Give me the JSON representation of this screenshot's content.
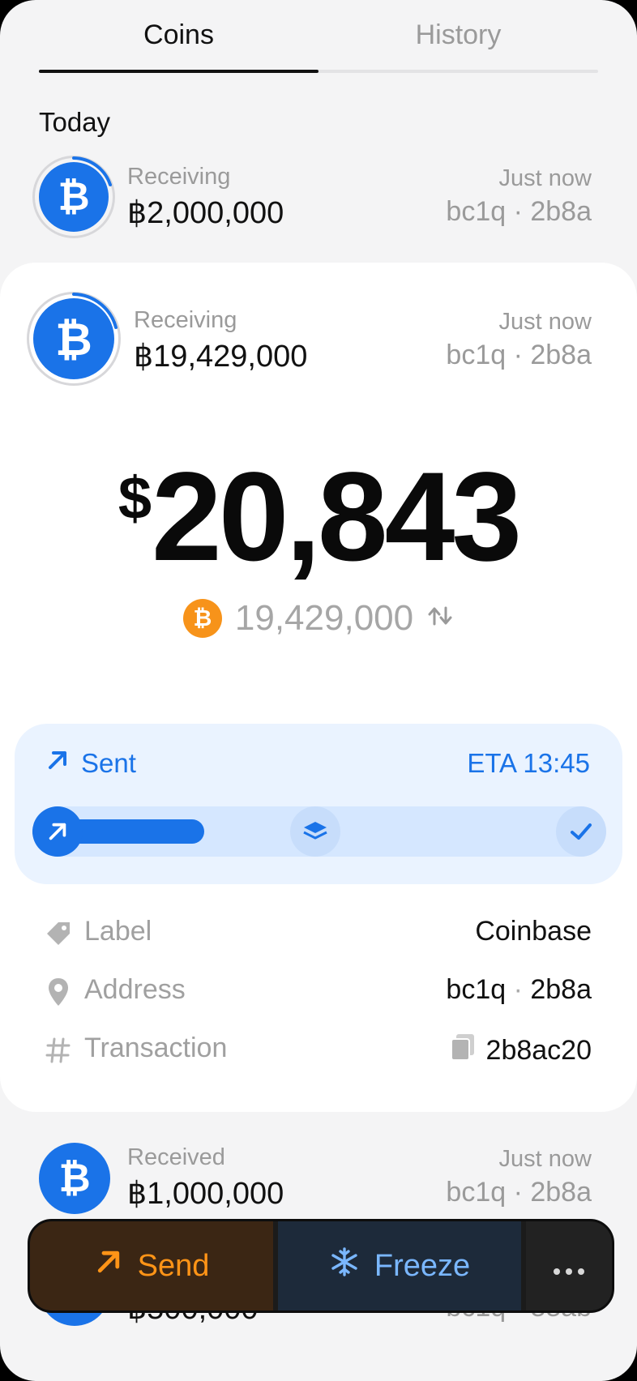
{
  "tabs": {
    "coins": "Coins",
    "history": "History"
  },
  "section_title": "Today",
  "rows": [
    {
      "label": "Receiving",
      "amount": "฿2,000,000",
      "time": "Just now",
      "address": "bc1q · 2b8a"
    },
    {
      "label": "Received",
      "amount": "฿1,000,000",
      "time": "Just now",
      "address": "bc1q · 2b8a"
    },
    {
      "amount": "฿500,000",
      "address": "bc1q · 88ab"
    }
  ],
  "detail": {
    "label": "Receiving",
    "amount": "฿19,429,000",
    "time": "Just now",
    "address": "bc1q · 2b8a",
    "fiat_symbol": "$",
    "fiat_amount": "20,843",
    "sats_amount": "19,429,000",
    "status": {
      "label": "Sent",
      "eta": "ETA 13:45",
      "progress": 0.3
    },
    "info": [
      {
        "label": "Label",
        "value": "Coinbase"
      },
      {
        "label": "Address",
        "value_prefix": "bc1q",
        "value_sep": " · ",
        "value_suffix": "2b8a"
      },
      {
        "label": "Transaction",
        "value": "2b8ac20"
      }
    ]
  },
  "actions": {
    "send": "Send",
    "freeze": "Freeze"
  },
  "icons": [
    "bitcoin-icon",
    "arrow-up-right-icon",
    "layers-icon",
    "check-icon",
    "tag-icon",
    "location-pin-icon",
    "hash-icon",
    "copy-icon",
    "snowflake-icon",
    "more-icon",
    "swap-icon"
  ],
  "colors": {
    "accent_blue": "#1a73e8",
    "bitcoin_orange": "#f7931a",
    "send_orange": "#ff9417",
    "freeze_blue": "#7ab7ff"
  }
}
